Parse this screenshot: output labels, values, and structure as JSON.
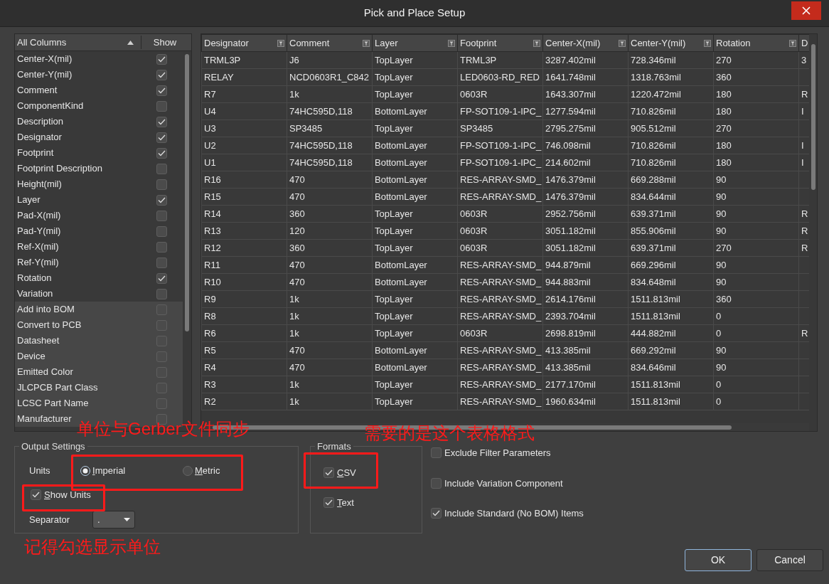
{
  "window": {
    "title": "Pick and Place Setup"
  },
  "column_list": {
    "headers": [
      "All Columns",
      "Show"
    ],
    "items": [
      {
        "label": "Center-X(mil)",
        "checked": true,
        "kind": "property"
      },
      {
        "label": "Center-Y(mil)",
        "checked": true,
        "kind": "property"
      },
      {
        "label": "Comment",
        "checked": true,
        "kind": "property"
      },
      {
        "label": "ComponentKind",
        "checked": false,
        "kind": "property"
      },
      {
        "label": "Description",
        "checked": true,
        "kind": "property"
      },
      {
        "label": "Designator",
        "checked": true,
        "kind": "property"
      },
      {
        "label": "Footprint",
        "checked": true,
        "kind": "property"
      },
      {
        "label": "Footprint Description",
        "checked": false,
        "kind": "property"
      },
      {
        "label": "Height(mil)",
        "checked": false,
        "kind": "property"
      },
      {
        "label": "Layer",
        "checked": true,
        "kind": "property"
      },
      {
        "label": "Pad-X(mil)",
        "checked": false,
        "kind": "property"
      },
      {
        "label": "Pad-Y(mil)",
        "checked": false,
        "kind": "property"
      },
      {
        "label": "Ref-X(mil)",
        "checked": false,
        "kind": "property"
      },
      {
        "label": "Ref-Y(mil)",
        "checked": false,
        "kind": "property"
      },
      {
        "label": "Rotation",
        "checked": true,
        "kind": "property"
      },
      {
        "label": "Variation",
        "checked": false,
        "kind": "property"
      },
      {
        "label": "Add into BOM",
        "checked": false,
        "kind": "parameter"
      },
      {
        "label": "Convert to PCB",
        "checked": false,
        "kind": "parameter"
      },
      {
        "label": "Datasheet",
        "checked": false,
        "kind": "parameter"
      },
      {
        "label": "Device",
        "checked": false,
        "kind": "parameter"
      },
      {
        "label": "Emitted Color",
        "checked": false,
        "kind": "parameter"
      },
      {
        "label": "JLCPCB Part Class",
        "checked": false,
        "kind": "parameter"
      },
      {
        "label": "LCSC Part Name",
        "checked": false,
        "kind": "parameter"
      },
      {
        "label": "Manufacturer",
        "checked": false,
        "kind": "parameter"
      }
    ]
  },
  "table": {
    "columns": [
      "Designator",
      "Comment",
      "Layer",
      "Footprint",
      "Center-X(mil)",
      "Center-Y(mil)",
      "Rotation",
      "D"
    ],
    "rows": [
      [
        "TRML3P",
        "J6",
        "TopLayer",
        "TRML3P",
        "3287.402mil",
        "728.346mil",
        "270",
        "3"
      ],
      [
        "RELAY",
        "NCD0603R1_C842",
        "TopLayer",
        "LED0603-RD_RED",
        "1641.748mil",
        "1318.763mil",
        "360",
        null
      ],
      [
        "R7",
        "1k",
        "TopLayer",
        "0603R",
        "1643.307mil",
        "1220.472mil",
        "180",
        "R"
      ],
      [
        "U4",
        "74HC595D,118",
        "BottomLayer",
        "FP-SOT109-1-IPC_",
        "1277.594mil",
        "710.826mil",
        "180",
        "I"
      ],
      [
        "U3",
        "SP3485",
        "TopLayer",
        "SP3485",
        "2795.275mil",
        "905.512mil",
        "270",
        null
      ],
      [
        "U2",
        "74HC595D,118",
        "BottomLayer",
        "FP-SOT109-1-IPC_",
        "746.098mil",
        "710.826mil",
        "180",
        "I"
      ],
      [
        "U1",
        "74HC595D,118",
        "BottomLayer",
        "FP-SOT109-1-IPC_",
        "214.602mil",
        "710.826mil",
        "180",
        "I"
      ],
      [
        "R16",
        "470",
        "BottomLayer",
        "RES-ARRAY-SMD_",
        "1476.379mil",
        "669.288mil",
        "90",
        null
      ],
      [
        "R15",
        "470",
        "BottomLayer",
        "RES-ARRAY-SMD_",
        "1476.379mil",
        "834.644mil",
        "90",
        null
      ],
      [
        "R14",
        "360",
        "TopLayer",
        "0603R",
        "2952.756mil",
        "639.371mil",
        "90",
        "R"
      ],
      [
        "R13",
        "120",
        "TopLayer",
        "0603R",
        "3051.182mil",
        "855.906mil",
        "90",
        "R"
      ],
      [
        "R12",
        "360",
        "TopLayer",
        "0603R",
        "3051.182mil",
        "639.371mil",
        "270",
        "R"
      ],
      [
        "R11",
        "470",
        "BottomLayer",
        "RES-ARRAY-SMD_",
        "944.879mil",
        "669.296mil",
        "90",
        null
      ],
      [
        "R10",
        "470",
        "BottomLayer",
        "RES-ARRAY-SMD_",
        "944.883mil",
        "834.648mil",
        "90",
        null
      ],
      [
        "R9",
        "1k",
        "TopLayer",
        "RES-ARRAY-SMD_",
        "2614.176mil",
        "1511.813mil",
        "360",
        null
      ],
      [
        "R8",
        "1k",
        "TopLayer",
        "RES-ARRAY-SMD_",
        "2393.704mil",
        "1511.813mil",
        "0",
        null
      ],
      [
        "R6",
        "1k",
        "TopLayer",
        "0603R",
        "2698.819mil",
        "444.882mil",
        "0",
        "R"
      ],
      [
        "R5",
        "470",
        "BottomLayer",
        "RES-ARRAY-SMD_",
        "413.385mil",
        "669.292mil",
        "90",
        null
      ],
      [
        "R4",
        "470",
        "BottomLayer",
        "RES-ARRAY-SMD_",
        "413.385mil",
        "834.646mil",
        "90",
        null
      ],
      [
        "R3",
        "1k",
        "TopLayer",
        "RES-ARRAY-SMD_",
        "2177.170mil",
        "1511.813mil",
        "0",
        null
      ],
      [
        "R2",
        "1k",
        "TopLayer",
        "RES-ARRAY-SMD_",
        "1960.634mil",
        "1511.813mil",
        "0",
        null
      ]
    ]
  },
  "output_settings": {
    "title": "Output Settings",
    "units_label": "Units",
    "units": [
      {
        "label": "Imperial",
        "key_underlined": true,
        "selected": true
      },
      {
        "label": "Metric",
        "key_underlined": true,
        "selected": false
      }
    ],
    "show_units": {
      "label": "Show Units",
      "key_underlined": true,
      "checked": true
    },
    "separator_label": "Separator",
    "separator_value": "."
  },
  "formats": {
    "title": "Formats",
    "items": [
      {
        "label": "CSV",
        "key_underlined": true,
        "checked": true
      },
      {
        "label": "Text",
        "key_underlined": true,
        "checked": true
      }
    ]
  },
  "options": [
    {
      "label": "Exclude Filter Parameters",
      "checked": false
    },
    {
      "label": "Include Variation Component",
      "checked": false
    },
    {
      "label": "Include Standard (No BOM) Items",
      "checked": true
    }
  ],
  "buttons": [
    "OK",
    "Cancel"
  ],
  "annotations": [
    "单位与Gerber文件同步",
    "需要的是这个表格格式",
    "记得勾选显示单位"
  ]
}
